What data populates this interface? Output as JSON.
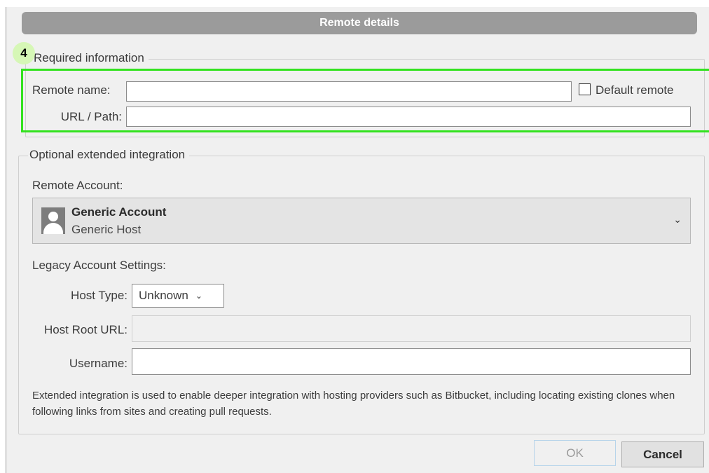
{
  "dialog": {
    "title": "Remote details",
    "step_badge": "4",
    "required": {
      "legend": "Required information",
      "remote_name_label": "Remote name:",
      "remote_name_value": "",
      "default_remote_label": "Default remote",
      "default_remote_checked": false,
      "url_label": "URL / Path:",
      "url_value": ""
    },
    "optional": {
      "legend": "Optional extended integration",
      "remote_account_label": "Remote Account:",
      "account": {
        "name": "Generic Account",
        "host": "Generic Host",
        "icon": "user-avatar-icon"
      },
      "legacy_label": "Legacy Account Settings:",
      "host_type_label": "Host Type:",
      "host_type_value": "Unknown",
      "host_root_label": "Host Root URL:",
      "host_root_value": "",
      "username_label": "Username:",
      "username_value": "",
      "help_text": "Extended integration is used to enable deeper integration with hosting providers such as Bitbucket, including locating existing clones when following links from sites and creating pull requests."
    },
    "buttons": {
      "ok": "OK",
      "cancel": "Cancel"
    }
  },
  "colors": {
    "highlight": "#33e21f",
    "badge": "#d6f7b6",
    "titlebar": "#9b9b9b"
  }
}
